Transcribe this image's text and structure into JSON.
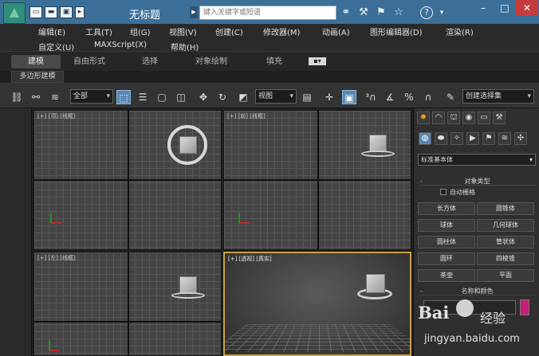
{
  "window": {
    "title": "无标题"
  },
  "quick_access": [
    "▭",
    "▬",
    "▣",
    "▸"
  ],
  "search": {
    "placeholder": "键入关键字或短语"
  },
  "title_icons": [
    "⚭",
    "⚒",
    "⚑",
    "☆",
    "?"
  ],
  "window_controls": {
    "minimize": "–",
    "maximize": "□",
    "close": "✕"
  },
  "menus": {
    "row1": [
      "编辑(E)",
      "工具(T)",
      "组(G)",
      "视图(V)",
      "创建(C)",
      "修改器(M)",
      "动画(A)",
      "图形编辑器(D)",
      "渲染(R)"
    ],
    "row2": [
      "自定义(U)",
      "MAXScript(X)",
      "帮助(H)"
    ]
  },
  "ribbon": {
    "tabs": [
      "建模",
      "自由形式",
      "选择",
      "对象绘制",
      "填充"
    ],
    "active_tab": "建模",
    "subtab": "多边形建模"
  },
  "toolbar": {
    "selection_filter": "全部",
    "reference_coord": "视图",
    "named_selection": "创建选择集"
  },
  "viewports": {
    "top_left": "[+] [顶] [线框]",
    "top_right": "[+] [前] [线框]",
    "bottom_left": "[+] [左] [线框]",
    "perspective": "[+] [透视] [真实]"
  },
  "command_panel": {
    "category_dropdown": "标准基本体",
    "object_type_header": "对象类型",
    "autogrid_label": "自动栅格",
    "objects": [
      "长方体",
      "圆锥体",
      "球体",
      "几何球体",
      "圆柱体",
      "管状体",
      "圆环",
      "四棱锥",
      "茶壶",
      "平面"
    ],
    "name_color_header": "名称和颜色",
    "object_color": "#c81e7a"
  },
  "watermark": {
    "logo": "Bai",
    "name": "经验",
    "url": "jingyan.baidu.com"
  }
}
